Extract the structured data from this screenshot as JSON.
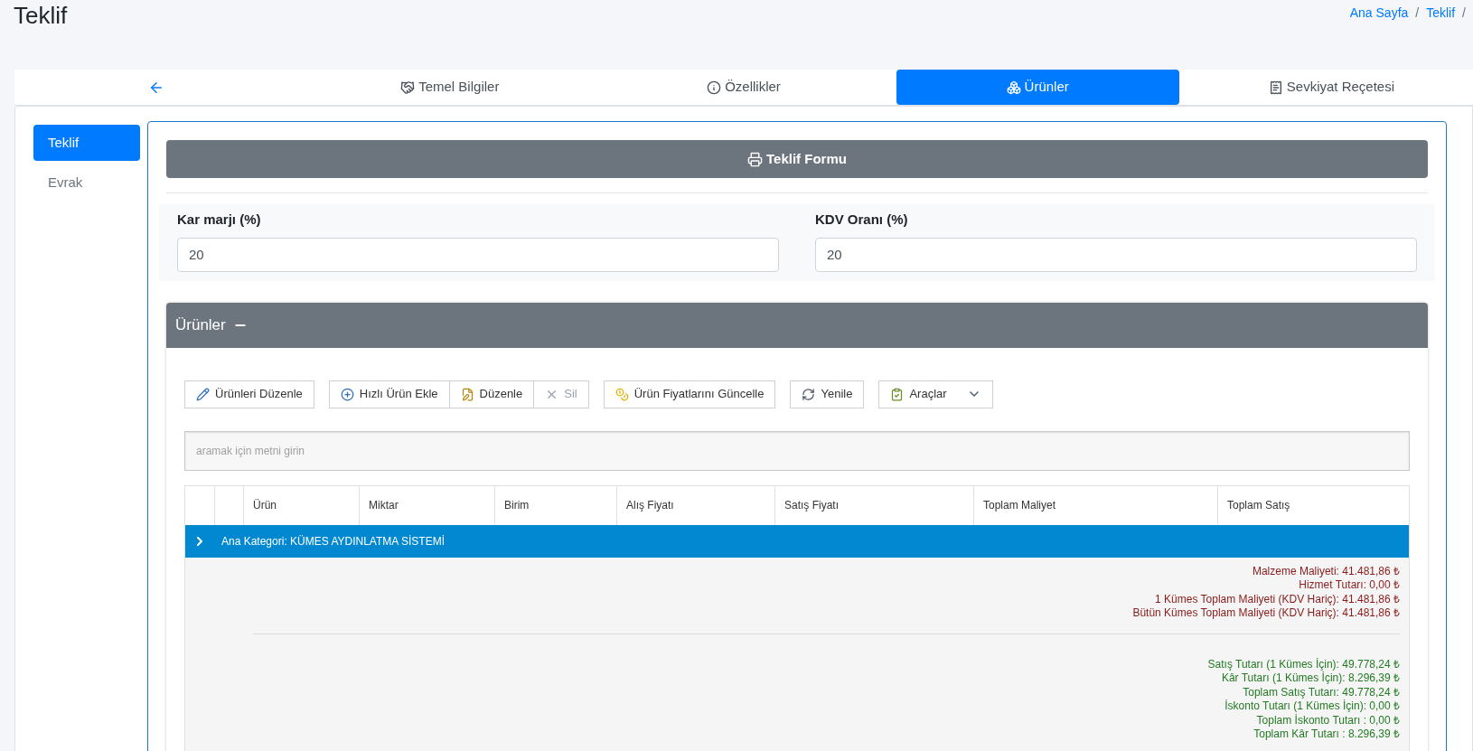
{
  "page": {
    "title": "Teklif"
  },
  "breadcrumb": [
    {
      "label": "Ana Sayfa",
      "separator": "/"
    },
    {
      "label": "Teklif",
      "separator": "/"
    }
  ],
  "tabs": [
    {
      "kind": "back",
      "selected": false
    },
    {
      "kind": "basic",
      "label": "Temel Bilgiler",
      "selected": false
    },
    {
      "kind": "info",
      "label": "Özellikler",
      "selected": false
    },
    {
      "kind": "products",
      "label": "Ürünler",
      "selected": true
    },
    {
      "kind": "shipping",
      "label": "Sevkiyat Reçetesi",
      "selected": false
    }
  ],
  "sidebar": {
    "items": [
      {
        "label": "Teklif",
        "selected": true
      },
      {
        "label": "Evrak",
        "selected": false
      }
    ]
  },
  "print_button": {
    "label": "Teklif Formu"
  },
  "fields": [
    {
      "label": "Kar marjı (%)",
      "value": "20"
    },
    {
      "label": "KDV Oranı (%)",
      "value": "20"
    }
  ],
  "products_card": {
    "title": "Ürünler",
    "toolbar": [
      {
        "kind": "edit-all",
        "label": "Ürünleri Düzenle",
        "disabled": false
      },
      {
        "kind": "quick-add",
        "label": "Hızlı Ürün Ekle",
        "disabled": false
      },
      {
        "kind": "edit",
        "label": "Düzenle",
        "disabled": false
      },
      {
        "kind": "delete",
        "label": "Sil",
        "disabled": true
      },
      {
        "kind": "prices",
        "label": "Ürün Fiyatlarını Güncelle",
        "disabled": false
      },
      {
        "kind": "refresh",
        "label": "Yenile",
        "disabled": false
      },
      {
        "kind": "tools",
        "label": "Araçlar",
        "disabled": false
      }
    ],
    "search": {
      "placeholder": "aramak için metni girin"
    },
    "table": {
      "columns": [
        "",
        "",
        "Ürün",
        "Miktar",
        "Birim",
        "Alış Fiyatı",
        "Satış Fiyatı",
        "Toplam Maliyet",
        "Toplam Satış"
      ],
      "groups": [
        {
          "label": "Ana Kategori: KÜMES AYDINLATMA SİSTEMİ",
          "expanded": false
        }
      ]
    },
    "cost_lines": [
      "Malzeme Maliyeti: 41.481,86 ₺",
      "Hizmet Tutarı: 0,00 ₺",
      "1 Kümes Toplam Maliyeti (KDV Hariç): 41.481,86 ₺",
      "Bütün Kümes Toplam Maliyeti (KDV Hariç): 41.481,86 ₺"
    ],
    "sales_lines": [
      "Satış Tutarı (1 Kümes İçin): 49.778,24 ₺",
      "Kâr Tutarı (1 Kümes İçin): 8.296,39 ₺",
      "Toplam Satış Tutarı: 49.778,24 ₺",
      "İskonto Tutarı (1 Kümes İçin): 0,00 ₺",
      "Toplam İskonto Tutarı : 0,00 ₺",
      "Toplam Kâr Tutarı : 8.296,39 ₺"
    ]
  }
}
